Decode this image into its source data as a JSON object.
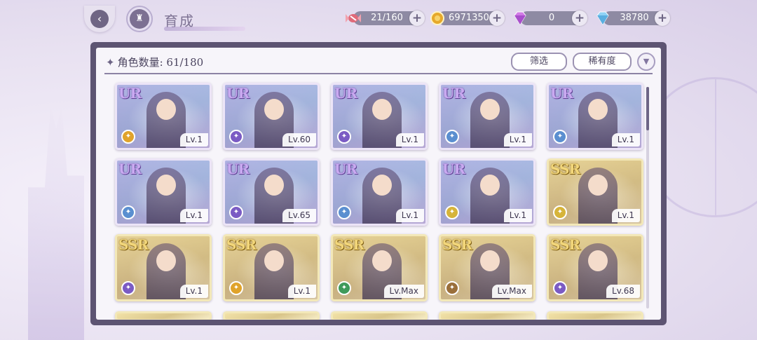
{
  "header": {
    "title": "育成"
  },
  "resources": [
    {
      "name": "stamina",
      "icon": "candy-icon",
      "value": "21/160",
      "color": "#e06a7a"
    },
    {
      "name": "gold",
      "icon": "coin-icon",
      "value": "6971350",
      "color": "#e0a32a"
    },
    {
      "name": "gem-pink",
      "icon": "pink-diamond-icon",
      "value": "0",
      "color": "#c070d8"
    },
    {
      "name": "gem-blue",
      "icon": "blue-diamond-icon",
      "value": "38780",
      "color": "#69b6e8"
    }
  ],
  "panel": {
    "count_label": "角色数量: 61/180",
    "filter_label": "筛选",
    "rarity_label": "稀有度"
  },
  "cards": [
    {
      "rarity": "UR",
      "level": "Lv.1",
      "element": "#e0a32a"
    },
    {
      "rarity": "UR",
      "level": "Lv.60",
      "element": "#7b5bc4"
    },
    {
      "rarity": "UR",
      "level": "Lv.1",
      "element": "#7b5bc4"
    },
    {
      "rarity": "UR",
      "level": "Lv.1",
      "element": "#5a8fd0"
    },
    {
      "rarity": "UR",
      "level": "Lv.1",
      "element": "#5a8fd0"
    },
    {
      "rarity": "UR",
      "level": "Lv.1",
      "element": "#5a8fd0"
    },
    {
      "rarity": "UR",
      "level": "Lv.65",
      "element": "#7b5bc4"
    },
    {
      "rarity": "UR",
      "level": "Lv.1",
      "element": "#5a8fd0"
    },
    {
      "rarity": "UR",
      "level": "Lv.1",
      "element": "#d6b43a"
    },
    {
      "rarity": "SSR",
      "level": "Lv.1",
      "element": "#d6b43a"
    },
    {
      "rarity": "SSR",
      "level": "Lv.1",
      "element": "#7b5bc4"
    },
    {
      "rarity": "SSR",
      "level": "Lv.1",
      "element": "#e0a32a"
    },
    {
      "rarity": "SSR",
      "level": "Lv.Max",
      "element": "#3f9a5a"
    },
    {
      "rarity": "SSR",
      "level": "Lv.Max",
      "element": "#9a6f3a"
    },
    {
      "rarity": "SSR",
      "level": "Lv.68",
      "element": "#7b5bc4"
    }
  ]
}
